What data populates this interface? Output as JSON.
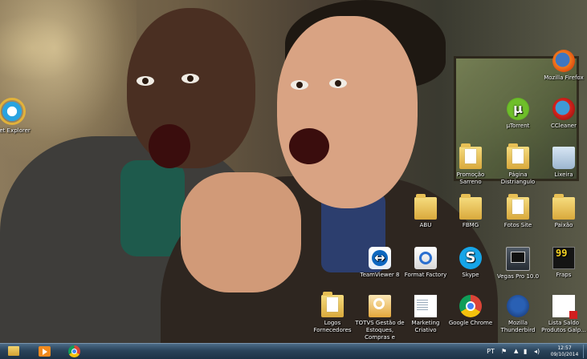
{
  "desktop": {
    "icons": [
      {
        "id": "internet-explorer",
        "label": "rnet Explorer",
        "icon": "internet-explorer-icon"
      },
      {
        "id": "mozilla-firefox",
        "label": "Mozilla Firefox",
        "icon": "firefox-icon"
      },
      {
        "id": "utorrent",
        "label": "µTorrent",
        "icon": "utorrent-icon"
      },
      {
        "id": "ccleaner",
        "label": "CCleaner",
        "icon": "ccleaner-icon"
      },
      {
        "id": "promocao-sarreno",
        "label": "Promoção\nSarreno",
        "icon": "folder-icon"
      },
      {
        "id": "pagina-distriangulo",
        "label": "Página\nDistriangulo",
        "icon": "folder-icon"
      },
      {
        "id": "lixeira",
        "label": "Lixeira",
        "icon": "recycle-bin-icon"
      },
      {
        "id": "abu",
        "label": "ABU",
        "icon": "folder-icon"
      },
      {
        "id": "fbmg",
        "label": "FBMG",
        "icon": "folder-icon"
      },
      {
        "id": "fotos-site",
        "label": "Fotos Site",
        "icon": "folder-icon"
      },
      {
        "id": "paixao",
        "label": "Paixão",
        "icon": "folder-icon"
      },
      {
        "id": "teamviewer",
        "label": "TeamViewer 8",
        "icon": "teamviewer-icon"
      },
      {
        "id": "format-factory",
        "label": "Format Factory",
        "icon": "format-factory-icon"
      },
      {
        "id": "skype",
        "label": "Skype",
        "icon": "skype-icon"
      },
      {
        "id": "vegas-pro",
        "label": "Vegas Pro 10.0",
        "icon": "vegas-pro-icon"
      },
      {
        "id": "fraps",
        "label": "Fraps",
        "icon": "fraps-icon",
        "glyph_text": "99"
      },
      {
        "id": "logos-fornecedores",
        "label": "Logos\nFornecedores",
        "icon": "folder-icon"
      },
      {
        "id": "totvs",
        "label": "TOTVS Gestão de\nEstoques,\nCompras e",
        "icon": "totvs-icon"
      },
      {
        "id": "marketing-criativo",
        "label": "Marketing\nCriativo",
        "icon": "document-icon"
      },
      {
        "id": "google-chrome",
        "label": "Google Chrome",
        "icon": "chrome-icon"
      },
      {
        "id": "mozilla-thunderbird",
        "label": "Mozilla\nThunderbird",
        "icon": "thunderbird-icon"
      },
      {
        "id": "lista-saldo",
        "label": "Lista Saldo\nProdutos Galp...",
        "icon": "pdf-document-icon"
      }
    ]
  },
  "taskbar": {
    "pinned": [
      "windows-explorer-icon",
      "media-player-icon",
      "chrome-icon"
    ],
    "tray": {
      "language": "PT",
      "time": "12:57",
      "date": "09/10/2014"
    }
  },
  "colors": {
    "taskbar_top": "#4c6c88",
    "taskbar_bottom": "#1d3246"
  }
}
